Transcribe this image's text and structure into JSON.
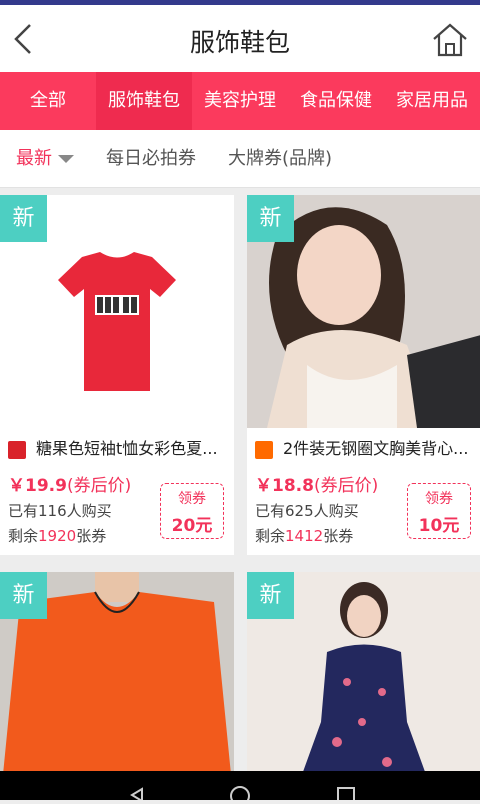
{
  "header": {
    "title": "服饰鞋包",
    "back_icon": "back-chevron-icon",
    "home_icon": "home-icon"
  },
  "categories": [
    {
      "label": "全部",
      "active": false
    },
    {
      "label": "服饰鞋包",
      "active": true
    },
    {
      "label": "美容护理",
      "active": false
    },
    {
      "label": "食品保健",
      "active": false
    },
    {
      "label": "家居用品",
      "active": false
    }
  ],
  "filters": {
    "latest": "最新",
    "daily": "每日必拍券",
    "brand": "大牌券(品牌)"
  },
  "products": [
    {
      "badge": "新",
      "shop_badge": "天猫",
      "name": "糖果色短袖t恤女彩色夏...",
      "price": "￥19.9",
      "price_note": "(券后价)",
      "sold": "已有116人购买",
      "remain_prefix": "剩余",
      "remain_count": "1920",
      "remain_suffix": "张券",
      "coupon_label": "领券",
      "coupon_value": "20元"
    },
    {
      "badge": "新",
      "shop_badge": "淘",
      "name": "2件装无钢圈文胸美背心...",
      "price": "￥18.8",
      "price_note": "(券后价)",
      "sold": "已有625人购买",
      "remain_prefix": "剩余",
      "remain_count": "1412",
      "remain_suffix": "张券",
      "coupon_label": "领券",
      "coupon_value": "10元"
    },
    {
      "badge": "新"
    },
    {
      "badge": "新"
    }
  ],
  "colors": {
    "brand": "#fb3a5d",
    "accent_text": "#f2325a",
    "new_badge": "#4dcfc2"
  }
}
